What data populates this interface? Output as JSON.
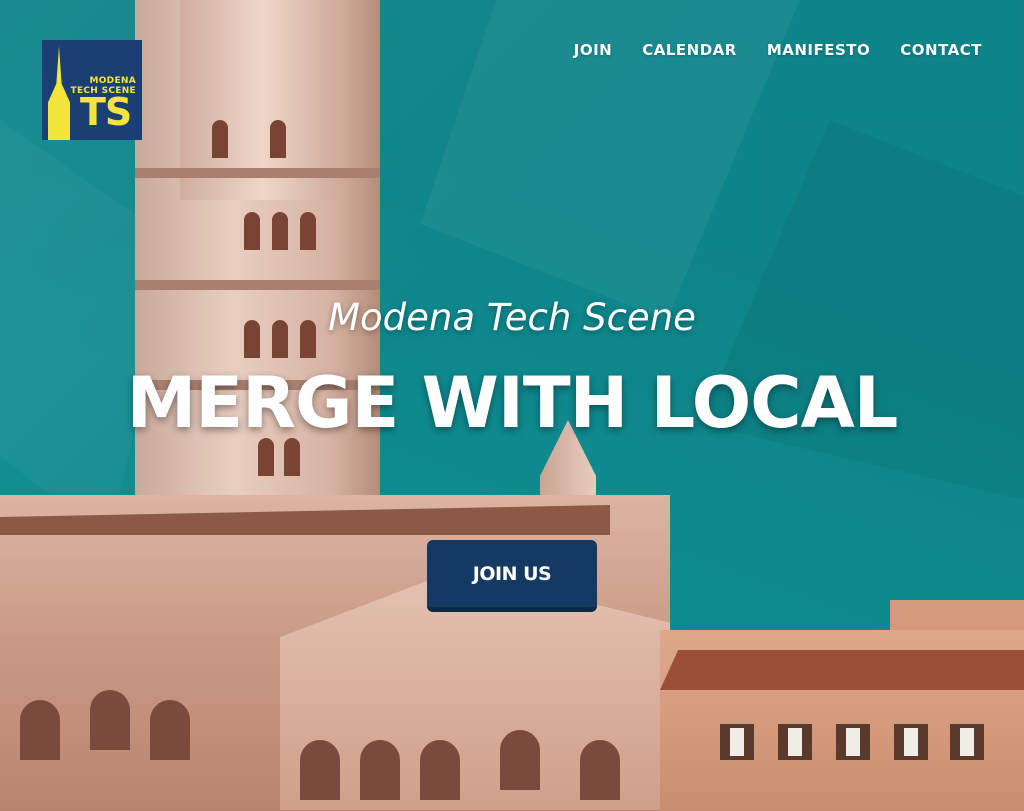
{
  "brand": {
    "logo_line1": "MODENA",
    "logo_line2": "TECH SCENE",
    "logo_mark": "TS",
    "logo_color": "#1c3f73",
    "logo_accent": "#f4e53a"
  },
  "nav": {
    "items": [
      {
        "label": "JOIN"
      },
      {
        "label": "CALENDAR"
      },
      {
        "label": "MANIFESTO"
      },
      {
        "label": "CONTACT"
      }
    ]
  },
  "hero": {
    "subtitle": "Modena Tech Scene",
    "headline": "MERGE WITH LOCAL",
    "cta_label": "JOIN US",
    "background_color": "#0e8b90",
    "cta_color": "#143a63"
  }
}
